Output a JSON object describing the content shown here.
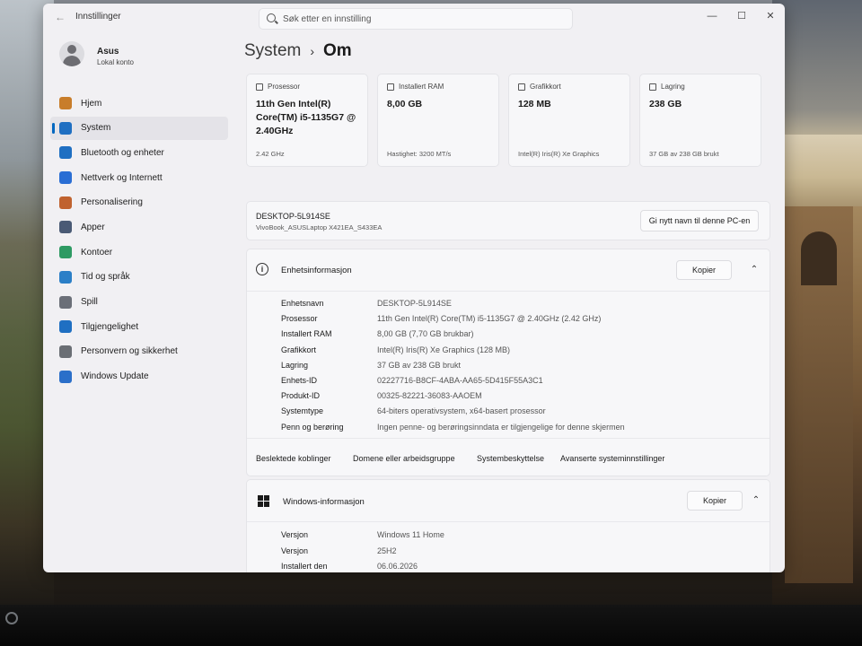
{
  "window": {
    "app_title": "Innstillinger",
    "search_placeholder": "Søk etter en innstilling",
    "controls": {
      "minimize": "—",
      "maximize": "☐",
      "close": "✕"
    }
  },
  "user": {
    "name": "Asus",
    "account_type": "Lokal konto"
  },
  "sidebar": {
    "items": [
      {
        "label": "Hjem",
        "icon": "home-icon",
        "color": "#c87d2a"
      },
      {
        "label": "System",
        "icon": "system-icon",
        "color": "#1f6fc2",
        "active": true
      },
      {
        "label": "Bluetooth og enheter",
        "icon": "bluetooth-icon",
        "color": "#1f6fc2"
      },
      {
        "label": "Nettverk og Internett",
        "icon": "network-icon",
        "color": "#2a6ed4"
      },
      {
        "label": "Personalisering",
        "icon": "brush-icon",
        "color": "#c0622f"
      },
      {
        "label": "Apper",
        "icon": "apps-icon",
        "color": "#4a5a75"
      },
      {
        "label": "Kontoer",
        "icon": "account-icon",
        "color": "#2e9a63"
      },
      {
        "label": "Tid og språk",
        "icon": "globe-clock-icon",
        "color": "#2b7fc7"
      },
      {
        "label": "Spill",
        "icon": "gamepad-icon",
        "color": "#6b6f78"
      },
      {
        "label": "Tilgjengelighet",
        "icon": "accessibility-icon",
        "color": "#1f6fc2"
      },
      {
        "label": "Personvern og sikkerhet",
        "icon": "shield-icon",
        "color": "#6a6e74"
      },
      {
        "label": "Windows Update",
        "icon": "update-icon",
        "color": "#2b6fc9"
      }
    ]
  },
  "breadcrumb": {
    "parent": "System",
    "separator": "›",
    "current": "Om"
  },
  "cards": [
    {
      "title": "Prosessor",
      "value": "11th Gen Intel(R) Core(TM) i5-1135G7 @ 2.40GHz",
      "sub": "2.42 GHz",
      "icon": "cpu-icon"
    },
    {
      "title": "Installert RAM",
      "value": "8,00 GB",
      "sub": "Hastighet: 3200 MT/s",
      "icon": "ram-icon"
    },
    {
      "title": "Grafikkort",
      "value": "128 MB",
      "sub": "Intel(R) Iris(R) Xe Graphics",
      "icon": "gpu-icon"
    },
    {
      "title": "Lagring",
      "value": "238 GB",
      "sub": "37 GB av 238 GB brukt",
      "icon": "storage-icon"
    }
  ],
  "device": {
    "name": "DESKTOP-5L914SE",
    "model": "VivoBook_ASUSLaptop X421EA_S433EA",
    "rename_label": "Gi nytt navn til denne PC-en"
  },
  "device_specs": {
    "title": "Enhetsinformasjon",
    "copy_label": "Kopier",
    "rows": [
      {
        "label": "Enhetsnavn",
        "value": "DESKTOP-5L914SE"
      },
      {
        "label": "Prosessor",
        "value": "11th Gen Intel(R) Core(TM) i5-1135G7 @ 2.40GHz (2.42 GHz)"
      },
      {
        "label": "Installert RAM",
        "value": "8,00 GB (7,70 GB brukbar)"
      },
      {
        "label": "Grafikkort",
        "value": "Intel(R) Iris(R) Xe Graphics (128 MB)"
      },
      {
        "label": "Lagring",
        "value": "37 GB av 238 GB brukt"
      },
      {
        "label": "Enhets-ID",
        "value": "02227716-B8CF-4ABA-AA65-5D415F55A3C1"
      },
      {
        "label": "Produkt-ID",
        "value": "00325-82221-36083-AAOEM"
      },
      {
        "label": "Systemtype",
        "value": "64-biters operativsystem, x64-basert prosessor"
      },
      {
        "label": "Penn og berøring",
        "value": "Ingen penne- og berøringsinndata er tilgjengelige for denne skjermen"
      }
    ],
    "related_label": "Beslektede koblinger",
    "related_links": [
      "Domene eller arbeidsgruppe",
      "Systembeskyttelse",
      "Avanserte systeminnstillinger"
    ]
  },
  "windows_specs": {
    "title": "Windows-informasjon",
    "copy_label": "Kopier",
    "rows": [
      {
        "label": "Versjon",
        "value": "Windows 11 Home"
      },
      {
        "label": "Versjon",
        "value": "25H2"
      },
      {
        "label": "Installert den",
        "value": "06.06.2026"
      }
    ]
  },
  "colors": {
    "accent": "#0067c0",
    "window_bg": "#f1f0f3",
    "card_bg": "#f7f7f9"
  }
}
